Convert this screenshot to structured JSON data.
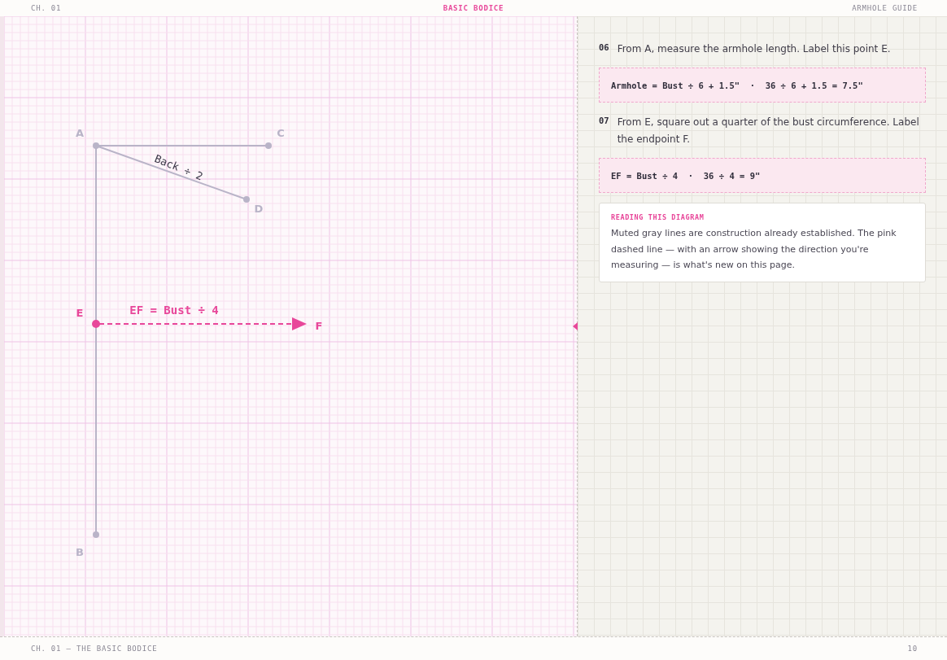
{
  "header": {
    "chapter": "CH. 01",
    "title": "BASIC BODICE",
    "section": "ARMHOLE GUIDE"
  },
  "diagram": {
    "points": [
      {
        "label": "A",
        "kind": "established"
      },
      {
        "label": "C",
        "kind": "established"
      },
      {
        "label": "D",
        "kind": "established"
      },
      {
        "label": "E",
        "kind": "new"
      },
      {
        "label": "F",
        "kind": "new"
      },
      {
        "label": "B",
        "kind": "established"
      }
    ],
    "measures": [
      {
        "label": "Back ÷ 2",
        "kind": "established"
      },
      {
        "label": "EF = Bust ÷ 4",
        "kind": "new"
      }
    ]
  },
  "steps": [
    {
      "number": "06",
      "text": "From A, measure the armhole length. Label this point E.",
      "formula": "Armhole = Bust ÷ 6 + 1.5\"  ·  36 ÷ 6 + 1.5 = 7.5\""
    },
    {
      "number": "07",
      "text": "From E, square out a quarter of the bust circumference. Label the endpoint F.",
      "formula": "EF = Bust ÷ 4  ·  36 ÷ 4 = 9\""
    }
  ],
  "note": {
    "title": "READING THIS DIAGRAM",
    "text": "Muted gray lines are construction already established. The pink dashed line — with an arrow showing the direction you're measuring — is what's new on this page."
  },
  "footer": {
    "running_title": "CH. 01 — THE BASIC BODICE",
    "page": "10"
  }
}
